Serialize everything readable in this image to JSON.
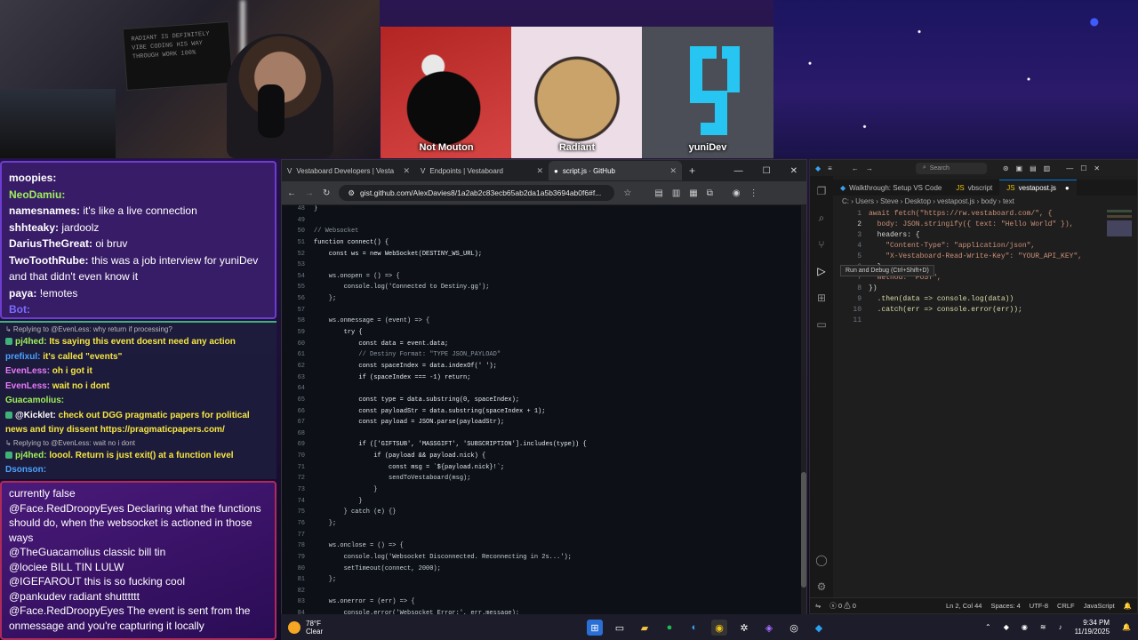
{
  "banner": {
    "poster_text": "RADIANT IS DEFINITELY\nVIBE CODING HIS WAY\nTHROUGH WORK 100%",
    "avatars": [
      {
        "name": "Not Mouton"
      },
      {
        "name": "Radiant"
      },
      {
        "name": "yuniDev"
      }
    ]
  },
  "chat_top": [
    {
      "user": "moopies:",
      "user_color": "#ffffff",
      "text": ""
    },
    {
      "user": "NeoDamiu:",
      "user_color": "#9ef05a",
      "text": ""
    },
    {
      "user": "namesnames:",
      "user_color": "#ffffff",
      "text": "it's like a live connection"
    },
    {
      "user": "shhteaky:",
      "user_color": "#ffffff",
      "text": "jardoolz"
    },
    {
      "user": "DariusTheGreat:",
      "user_color": "#ffffff",
      "text": "oi bruv"
    },
    {
      "user": "TwoToothRube:",
      "user_color": "#ffffff",
      "text": "this was a job interview for yuniDev and that didn't even know it"
    },
    {
      "user": "paya:",
      "user_color": "#ffffff",
      "text": "!emotes"
    },
    {
      "user": "Bot:",
      "user_color": "#7a6cff",
      "text": ""
    }
  ],
  "chat_mid": [
    {
      "reply": "Replying to @EvenLess: why return if processing?"
    },
    {
      "user": "pj4hed:",
      "user_color": "#9ef05a",
      "text": "Its saying this event doesnt need any action",
      "badge": true
    },
    {
      "user": "prefixul:",
      "user_color": "#4aa3ff",
      "text": "it's called \"events\""
    },
    {
      "user": "EvenLess:",
      "user_color": "#e879f9",
      "text": "oh i got it"
    },
    {
      "user": "EvenLess:",
      "user_color": "#e879f9",
      "text": "wait no i dont"
    },
    {
      "user": "Guacamolius:",
      "user_color": "#9ef05a",
      "text": ""
    },
    {
      "user": "@Kicklet:",
      "user_color": "#ffffff",
      "text": "check out DGG pragmatic papers for political news and tiny dissent https://pragmaticpapers.com/",
      "badge": true
    },
    {
      "reply": "Replying to @EvenLess: wait no i dont"
    },
    {
      "user": "pj4hed:",
      "user_color": "#9ef05a",
      "text": "loool. Return is just exit() at a function level",
      "badge": true
    },
    {
      "user": "Dsonson:",
      "user_color": "#4aa3ff",
      "text": ""
    }
  ],
  "chat_bottom": [
    {
      "user": "",
      "text": "currently false"
    },
    {
      "user": "@Face.RedDroopyEyes",
      "text": "Declaring what the functions should do, when the websocket is actioned in those ways"
    },
    {
      "user": "@TheGuacamolius",
      "text": "classic bill tin"
    },
    {
      "user": "@lociee",
      "text": "BILL TIN LULW"
    },
    {
      "user": "@IGEFAROUT",
      "text": "this is so fucking cool"
    },
    {
      "user": "@pankudev",
      "text": "radiant shutttttt"
    },
    {
      "user": "@Face.RedDroopyEyes",
      "text": "The event is sent from the onmessage and you're capturing it locally"
    }
  ],
  "browser": {
    "tabs": [
      {
        "label": "Vestaboard Developers | Vesta"
      },
      {
        "label": "Endpoints | Vestaboard"
      },
      {
        "label": "script.js · GitHub"
      }
    ],
    "url": "gist.github.com/AlexDavies8/1a2ab2c83ecb65ab2da1a5b3694ab0f6#f...",
    "new_tab": "+"
  },
  "gist_code": [
    {
      "n": "48",
      "t": "}"
    },
    {
      "n": "49",
      "t": ""
    },
    {
      "n": "50",
      "t": "// Websocket",
      "c": "cm"
    },
    {
      "n": "51",
      "t": "function connect() {"
    },
    {
      "n": "52",
      "t": "    const ws = new WebSocket(DESTINY_WS_URL);"
    },
    {
      "n": "53",
      "t": ""
    },
    {
      "n": "54",
      "t": "    ws.onopen = () => {"
    },
    {
      "n": "55",
      "t": "        console.log('Connected to Destiny.gg');"
    },
    {
      "n": "56",
      "t": "    };"
    },
    {
      "n": "57",
      "t": ""
    },
    {
      "n": "58",
      "t": "    ws.onmessage = (event) => {"
    },
    {
      "n": "59",
      "t": "        try {"
    },
    {
      "n": "60",
      "t": "            const data = event.data;"
    },
    {
      "n": "61",
      "t": "            // Destiny Format: \"TYPE JSON_PAYLOAD\"",
      "c": "cm"
    },
    {
      "n": "62",
      "t": "            const spaceIndex = data.indexOf(' ');"
    },
    {
      "n": "63",
      "t": "            if (spaceIndex === -1) return;"
    },
    {
      "n": "64",
      "t": ""
    },
    {
      "n": "65",
      "t": "            const type = data.substring(0, spaceIndex);"
    },
    {
      "n": "66",
      "t": "            const payloadStr = data.substring(spaceIndex + 1);"
    },
    {
      "n": "67",
      "t": "            const payload = JSON.parse(payloadStr);"
    },
    {
      "n": "68",
      "t": ""
    },
    {
      "n": "69",
      "t": "            if (['GIFTSUB', 'MASSGIFT', 'SUBSCRIPTION'].includes(type)) {"
    },
    {
      "n": "70",
      "t": "                if (payload && payload.nick) {"
    },
    {
      "n": "71",
      "t": "                    const msg = `${payload.nick}!`;"
    },
    {
      "n": "72",
      "t": "                    sendToVestaboard(msg);"
    },
    {
      "n": "73",
      "t": "                }"
    },
    {
      "n": "74",
      "t": "            }"
    },
    {
      "n": "75",
      "t": "        } catch (e) {}"
    },
    {
      "n": "76",
      "t": "    };"
    },
    {
      "n": "77",
      "t": ""
    },
    {
      "n": "78",
      "t": "    ws.onclose = () => {"
    },
    {
      "n": "79",
      "t": "        console.log('Websocket Disconnected. Reconnecting in 2s...');"
    },
    {
      "n": "80",
      "t": "        setTimeout(connect, 2000);"
    },
    {
      "n": "81",
      "t": "    };"
    },
    {
      "n": "82",
      "t": ""
    },
    {
      "n": "83",
      "t": "    ws.onerror = (err) => {"
    },
    {
      "n": "84",
      "t": "        console.error('Websocket Error:', err.message);"
    }
  ],
  "vscode": {
    "search": "Search",
    "tabs": [
      {
        "label": "Walkthrough: Setup VS Code"
      },
      {
        "label": "vbscript"
      },
      {
        "label": "vestapost.js"
      }
    ],
    "breadcrumb": "C: › Users › Steve › Desktop › vestapost.js › body › text",
    "tooltip": "Run and Debug (Ctrl+Shift+D)",
    "code": [
      {
        "n": "1",
        "t": "await fetch(\"https://rw.vestaboard.com/\", {"
      },
      {
        "n": "2",
        "t": "  body: JSON.stringify({ text: \"Hello World\" }),"
      },
      {
        "n": "3",
        "t": "  headers: {"
      },
      {
        "n": "4",
        "t": "    \"Content-Type\": \"application/json\","
      },
      {
        "n": "5",
        "t": "    \"X-Vestaboard-Read-Write-Key\": \"YOUR_API_KEY\","
      },
      {
        "n": "6",
        "t": "  },"
      },
      {
        "n": "7",
        "t": "  method: \"POST\","
      },
      {
        "n": "8",
        "t": "})"
      },
      {
        "n": "9",
        "t": "  .then(data => console.log(data))"
      },
      {
        "n": "10",
        "t": "  .catch(err => console.error(err));"
      },
      {
        "n": "11",
        "t": ""
      }
    ],
    "status": {
      "errors": "0",
      "warnings": "0",
      "position": "Ln 2, Col 44",
      "spaces": "Spaces: 4",
      "encoding": "UTF-8",
      "eol": "CRLF",
      "language": "JavaScript"
    }
  },
  "taskbar": {
    "temp": "78°F",
    "weather": "Clear",
    "time": "9:34 PM",
    "date": "11/19/2025"
  },
  "colors": {
    "accent_vscode": "#0078d4",
    "chat_border_top": "#6d3cd0",
    "chat_border_bottom": "#b02a5a"
  }
}
